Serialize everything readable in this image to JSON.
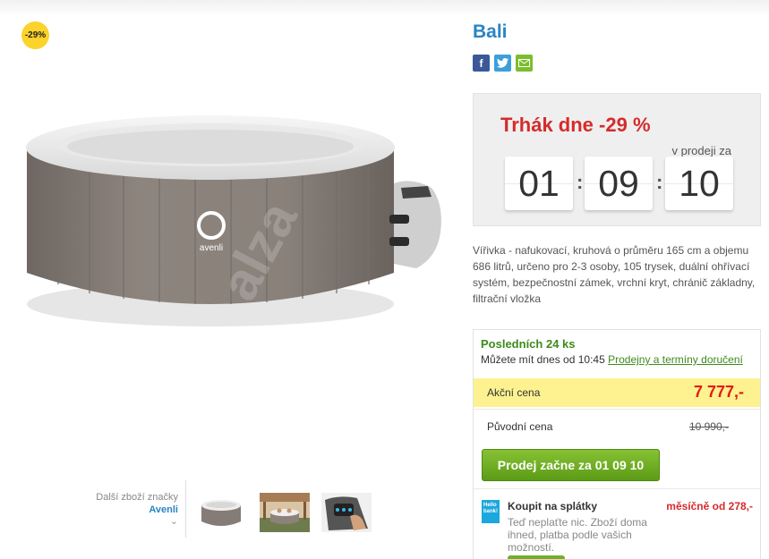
{
  "badge": "-29%",
  "gallery": {
    "more_label": "Další zboží značky",
    "brand": "Avenli",
    "logo_text": "avenli",
    "watermark": "alza",
    "thumbnails": [
      "hot-tub",
      "hot-tub-garden",
      "control-panel"
    ]
  },
  "product": {
    "title": "Bali",
    "share": [
      "facebook-icon",
      "twitter-icon",
      "email-icon"
    ],
    "description": "Vířivka - nafukovací, kruhová o průměru 165 cm a objemu 686 litrů, určeno pro 2-3 osoby, 105 trysek, duální ohřívací systém, bezpečnostní zámek, vrchní kryt, chránič základny, filtrační vložka"
  },
  "deal": {
    "title": "Trhák dne -29 %",
    "subtitle": "v prodeji za",
    "countdown": [
      "01",
      "09",
      "10"
    ],
    "separator": ":"
  },
  "stock": {
    "title": "Posledních 24 ks",
    "sub_prefix": "Můžete mít dnes od 10:45",
    "link": "Prodejny a termíny doručení"
  },
  "price": {
    "action_label": "Akční cena",
    "action_value": "7 777,-",
    "orig_label": "Původní cena",
    "orig_value": "10 990,-"
  },
  "sale_button": "Prodej začne za 01 09 10",
  "installment": {
    "icon_text": "Hello bank!",
    "title": "Koupit na splátky",
    "price": "měsíčně od 278,-",
    "text": "Teď neplaťte nic. Zboží doma ihned, platba podle vašich možností."
  },
  "colors": {
    "accent_blue": "#2a84c4",
    "deal_red": "#d52b2b",
    "stock_green": "#3f8a1c",
    "price_highlight": "#fdf28f",
    "button_green": "#6fb324"
  }
}
